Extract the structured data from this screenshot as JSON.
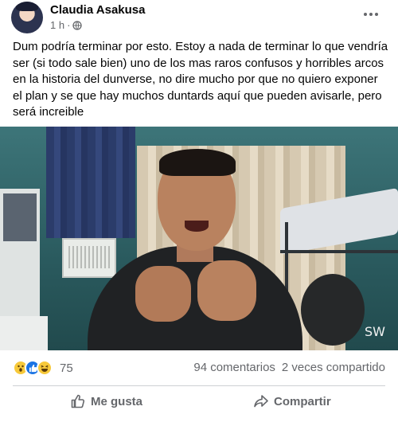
{
  "post": {
    "author": "Claudia Asakusa",
    "time": "1 h",
    "separator": "·",
    "text": "Dum podría terminar por esto. Estoy a nada de terminar lo que vendría ser (si todo sale bien) uno de los mas raros confusos y horribles arcos en la historia del dunverse, no dire mucho por que no quiero exponer el plan y se que hay muchos duntards aquí que pueden avisarle, pero será increible",
    "media_watermark": "SW",
    "reactions": {
      "icons": [
        "wow-icon",
        "like-icon",
        "haha-icon"
      ],
      "count": "75"
    },
    "comments_label": "94 comentarios",
    "shares_label": "2 veces compartido",
    "actions": {
      "like_label": "Me gusta",
      "share_label": "Compartir"
    }
  },
  "colors": {
    "accent": "#1b74e4",
    "secondary_text": "#65676b",
    "divider": "#ced0d4"
  }
}
